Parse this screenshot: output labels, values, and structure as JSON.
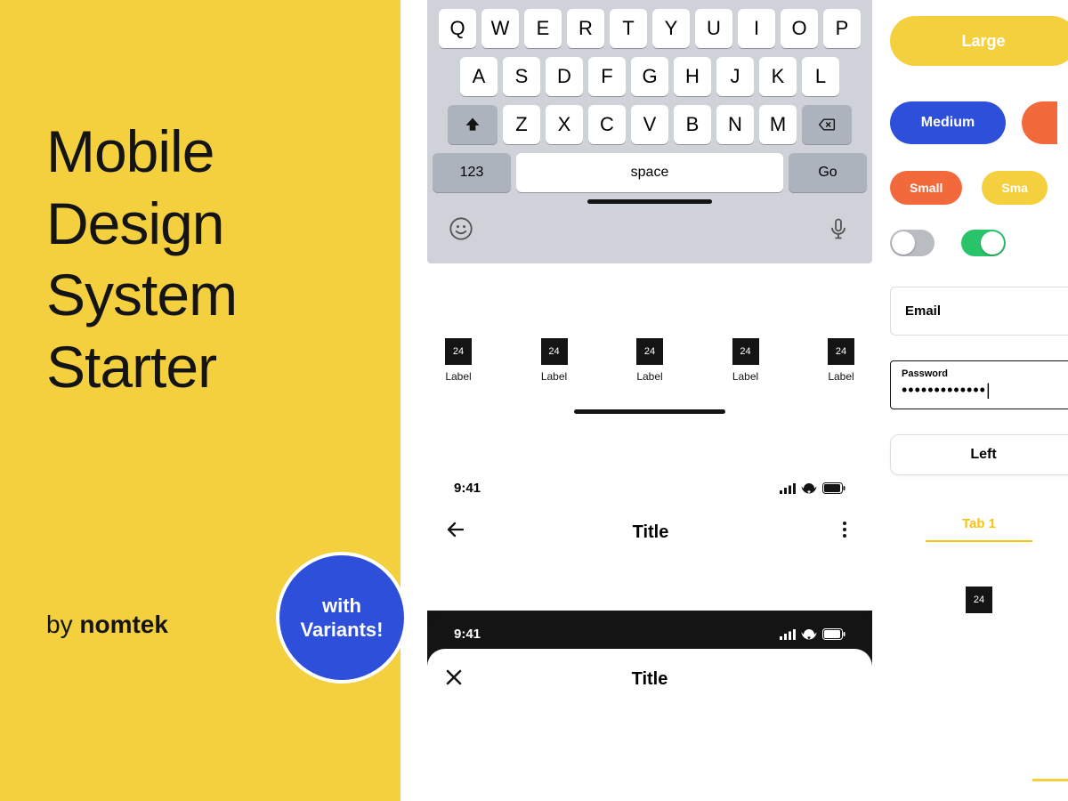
{
  "hero": {
    "title_l1": "Mobile",
    "title_l2": "Design",
    "title_l3": "System",
    "title_l4": "Starter",
    "by": "by ",
    "brand": "nomtek",
    "badge_l1": "with",
    "badge_l2": "Variants!"
  },
  "keyboard": {
    "row1": [
      "Q",
      "W",
      "E",
      "R",
      "T",
      "Y",
      "U",
      "I",
      "O",
      "P"
    ],
    "row2": [
      "A",
      "S",
      "D",
      "F",
      "G",
      "H",
      "J",
      "K",
      "L"
    ],
    "row3": [
      "Z",
      "X",
      "C",
      "V",
      "B",
      "N",
      "M"
    ],
    "numbers": "123",
    "space": "space",
    "go": "Go"
  },
  "tabbar": {
    "items": [
      {
        "size": "24",
        "label": "Label"
      },
      {
        "size": "24",
        "label": "Label"
      },
      {
        "size": "24",
        "label": "Label"
      },
      {
        "size": "24",
        "label": "Label"
      },
      {
        "size": "24",
        "label": "Label"
      }
    ]
  },
  "status": {
    "time": "9:41"
  },
  "navbar": {
    "title": "Title"
  },
  "status_dark": {
    "time": "9:41"
  },
  "navbar_dark": {
    "title": "Title"
  },
  "buttons": {
    "large": "Large",
    "medium": "Medium",
    "small": "Small",
    "small2": "Sma"
  },
  "inputs": {
    "email": "Email",
    "password_label": "Password",
    "password_value": "•••••••••••••"
  },
  "segment": {
    "left": "Left"
  },
  "tabs": {
    "tab1": "Tab 1"
  },
  "right_icon": "24"
}
